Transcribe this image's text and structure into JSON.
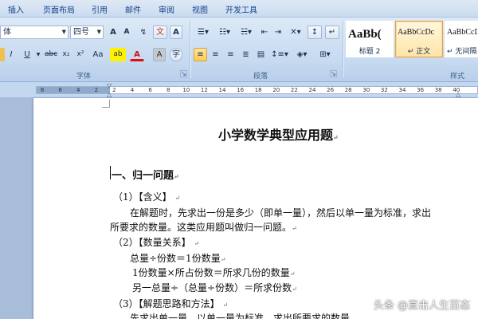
{
  "ribbon_tabs": [
    "插入",
    "页面布局",
    "引用",
    "邮件",
    "审阅",
    "视图",
    "开发工具"
  ],
  "font_group": {
    "font_name": "体",
    "font_size": "四号",
    "grow_label": "A",
    "shrink_label": "A",
    "phonetic_label": "文",
    "border_char_label": "A",
    "underline_label": "U",
    "strike_label": "abc",
    "subscript_label": "x₂",
    "superscript_label": "x²",
    "case_label": "Aa",
    "highlight_label": "ab",
    "font_color_label": "A",
    "shading_label": "A",
    "enclose_label": "字",
    "label": "字体"
  },
  "paragraph_group": {
    "label": "段落"
  },
  "styles_group": {
    "label": "样式",
    "items": [
      {
        "sample": "AaBb(",
        "name": "标题 2"
      },
      {
        "sample": "AaBbCcDc",
        "name": "↵ 正文"
      },
      {
        "sample": "AaBbCcDc",
        "name": "↵ 无间隔"
      }
    ]
  },
  "ruler": {
    "numbers": [
      "8",
      "6",
      "4",
      "2",
      "2",
      "4",
      "6",
      "8",
      "10",
      "12",
      "14",
      "16",
      "18",
      "20",
      "22",
      "24",
      "26",
      "28",
      "30",
      "32",
      "34",
      "36",
      "38",
      "40"
    ]
  },
  "document": {
    "title": "小学数学典型应用题",
    "section_heading": "一、归一问题",
    "item1_label": "（1）【含义】",
    "item1_body_a": "在解题时，先求出一份是多少（即单一量），然后以单一量为标准，求出",
    "item1_body_b": "所要求的数量。这类应用题叫做归一问题。",
    "item2_label": "（2）【数量关系】",
    "formula_1": "总量÷份数＝1份数量",
    "formula_2": "1份数量×所占份数＝所求几份的数量",
    "formula_3": "另一总量÷（总量÷份数）＝所求份数",
    "item3_label": "（3）【解题思路和方法】",
    "item3_body_a": "先求出单一量，以单一量为标准，求出所要求的数量。",
    "paragraph_mark": "↵"
  },
  "watermark": "头条 @直击人生百态"
}
